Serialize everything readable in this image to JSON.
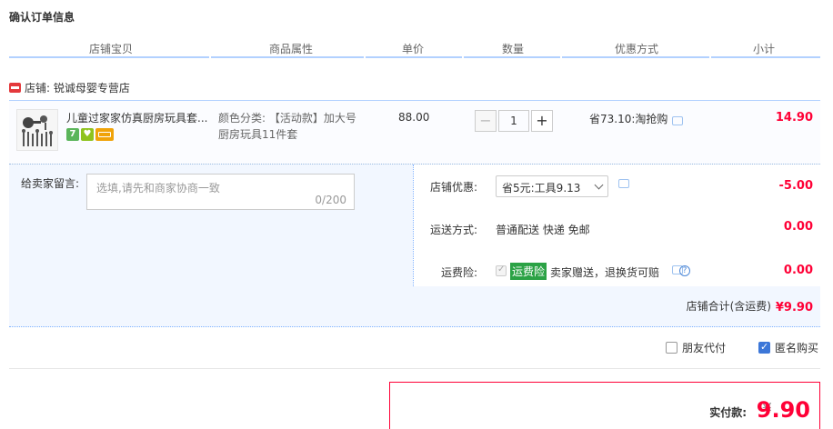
{
  "section_title": "确认订单信息",
  "columns": [
    "店铺宝贝",
    "商品属性",
    "单价",
    "数量",
    "优惠方式",
    "小计"
  ],
  "shop": {
    "label": "店铺: 锐诚母婴专营店"
  },
  "item": {
    "title": "儿童过家家仿真厨房玩具套...",
    "badges": [
      {
        "text": "7",
        "color": "#5bb55b",
        "icon": "7-day-return-badge"
      },
      {
        "text": "♥",
        "color": "#8fc31f",
        "icon": "heart-badge"
      },
      {
        "text": "",
        "color": "#f0a30a",
        "icon": "card-badge"
      }
    ],
    "sku_line1": "颜色分类: 【活动款】加大号",
    "sku_line2": "厨房玩具11件套",
    "unit_price": "88.00",
    "quantity": "1",
    "minus": "−",
    "plus": "+",
    "promo": "省73.10:淘抢购",
    "subtotal": "14.90"
  },
  "message": {
    "label": "给卖家留言:",
    "placeholder": "选填,请先和商家协商一致",
    "count": "0/200"
  },
  "shop_discount": {
    "label": "店铺优惠:",
    "selected": "省5元:工具9.13",
    "amount": "-5.00"
  },
  "shipping": {
    "label": "运送方式:",
    "value": "普通配送 快递 免邮",
    "amount": "0.00"
  },
  "insurance": {
    "label": "运费险:",
    "tag": "运费险",
    "desc": "卖家赠送，退换货可赔",
    "help": "?",
    "amount": "0.00"
  },
  "shop_total": {
    "label": "店铺合计(含运费)",
    "value": "¥9.90"
  },
  "options": {
    "friend_pay": "朋友代付",
    "anonymous": "匿名购买",
    "friend_pay_checked": false,
    "anonymous_checked": true
  },
  "payment": {
    "label": "实付款:",
    "currency": "¥",
    "amount": "9.90"
  },
  "colors": {
    "accent_red": "#ff0036",
    "header_line": "#b2d1ff",
    "detail_bg": "#f2f7ff",
    "checkbox_blue": "#3c77d8"
  }
}
